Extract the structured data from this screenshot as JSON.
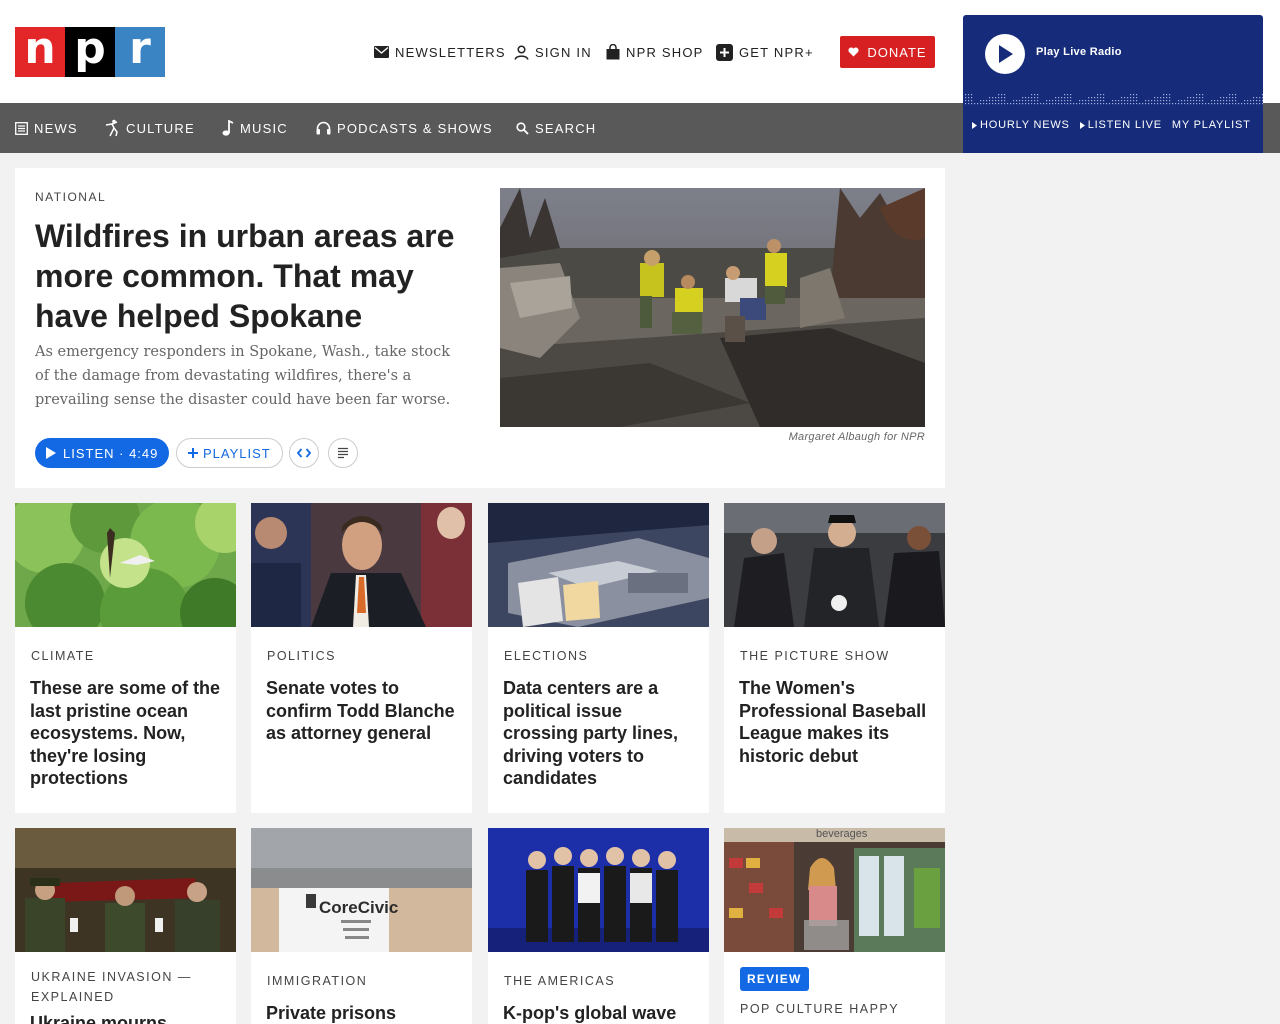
{
  "logo": {
    "letters": [
      "n",
      "p",
      "r"
    ]
  },
  "utility": {
    "newsletters": "NEWSLETTERS",
    "sign_in": "SIGN IN",
    "shop": "NPR SHOP",
    "plus": "GET NPR+",
    "donate": "DONATE"
  },
  "nav": {
    "items": [
      {
        "label": "NEWS",
        "icon": "news-icon"
      },
      {
        "label": "CULTURE",
        "icon": "culture-icon"
      },
      {
        "label": "MUSIC",
        "icon": "music-note-icon"
      },
      {
        "label": "PODCASTS & SHOWS",
        "icon": "headphones-icon"
      },
      {
        "label": "SEARCH",
        "icon": "search-icon"
      }
    ]
  },
  "player": {
    "play_label": "Play Live Radio",
    "links": [
      "HOURLY NEWS",
      "LISTEN LIVE",
      "MY PLAYLIST"
    ]
  },
  "featured": {
    "kicker": "NATIONAL",
    "title": "Wildfires in urban areas are more common. That may have helped Spokane",
    "teaser": "As emergency responders in Spokane, Wash., take stock of the damage from devastating wildfires, there's a prevailing sense the disaster could have been far worse.",
    "listen": "LISTEN · 4:49",
    "playlist": "PLAYLIST",
    "credit": "Margaret Albaugh for NPR"
  },
  "cards_row1": [
    {
      "kicker": "CLIMATE",
      "title": "These are some of the last pristine ocean ecosystems. Now, they're losing protections"
    },
    {
      "kicker": "POLITICS",
      "title": "Senate votes to confirm Todd Blanche as attorney general"
    },
    {
      "kicker": "ELECTIONS",
      "title": "Data centers are a political issue crossing party lines, driving voters to candidates"
    },
    {
      "kicker": "THE PICTURE SHOW",
      "title": "The Women's Professional Baseball League makes its historic debut"
    }
  ],
  "cards_row2": [
    {
      "kicker": "UKRAINE INVASION — EXPLAINED",
      "title": "Ukraine mourns"
    },
    {
      "kicker": "IMMIGRATION",
      "title": "Private prisons"
    },
    {
      "kicker": "THE AMERICAS",
      "title": "K-pop's global wave"
    },
    {
      "badge": "REVIEW",
      "kicker": "POP CULTURE HAPPY",
      "title": ""
    }
  ],
  "image_text": {
    "corecivic": "CoreCivic",
    "beverages": "beverages"
  }
}
